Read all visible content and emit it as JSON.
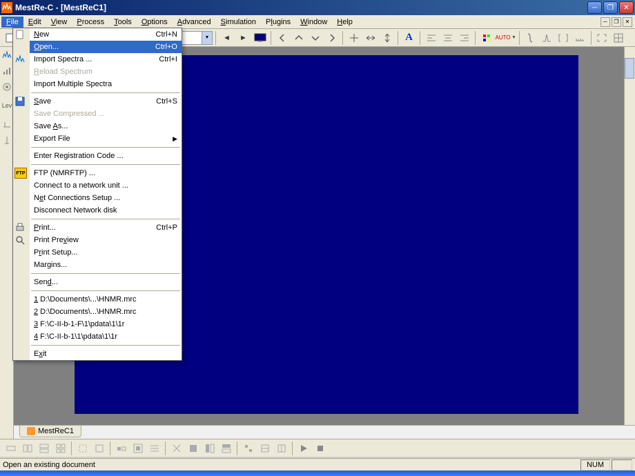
{
  "title": "MestRe-C - [MestReC1]",
  "menubar": [
    "File",
    "Edit",
    "View",
    "Process",
    "Tools",
    "Options",
    "Advanced",
    "Simulation",
    "Plugins",
    "Window",
    "Help"
  ],
  "file_menu": {
    "new": {
      "label": "New",
      "shortcut": "Ctrl+N"
    },
    "open": {
      "label": "Open...",
      "shortcut": "Ctrl+O"
    },
    "import_spectra": {
      "label": "Import Spectra ...",
      "shortcut": "Ctrl+I"
    },
    "reload": {
      "label": "Reload Spectrum"
    },
    "import_multi": {
      "label": "Import Multiple Spectra"
    },
    "save": {
      "label": "Save",
      "shortcut": "Ctrl+S"
    },
    "save_comp": {
      "label": "Save Compressed ..."
    },
    "save_as": {
      "label": "Save As..."
    },
    "export": {
      "label": "Export File"
    },
    "reg": {
      "label": "Enter Registration Code ..."
    },
    "ftp": {
      "label": "FTP (NMRFTP) ..."
    },
    "connect": {
      "label": "Connect to a network unit ..."
    },
    "net_setup": {
      "label": "Net Connections Setup ..."
    },
    "disconnect": {
      "label": "Disconnect Network disk"
    },
    "print": {
      "label": "Print...",
      "shortcut": "Ctrl+P"
    },
    "preview": {
      "label": "Print Preview"
    },
    "psetup": {
      "label": "Print Setup..."
    },
    "margins": {
      "label": "Margins..."
    },
    "send": {
      "label": "Send..."
    },
    "recent1": {
      "label": "1 D:\\Documents\\...\\HNMR.mrc"
    },
    "recent2": {
      "label": "2 D:\\Documents\\...\\HNMR.mrc"
    },
    "recent3": {
      "label": "3 F:\\C-II-b-1-F\\1\\pdata\\1\\1r"
    },
    "recent4": {
      "label": "4 F:\\C-II-b-1\\1\\pdata\\1\\1r"
    },
    "exit": {
      "label": "Exit"
    }
  },
  "doc_tab": "MestReC1",
  "status": "Open an existing document",
  "status_num": "NUM"
}
